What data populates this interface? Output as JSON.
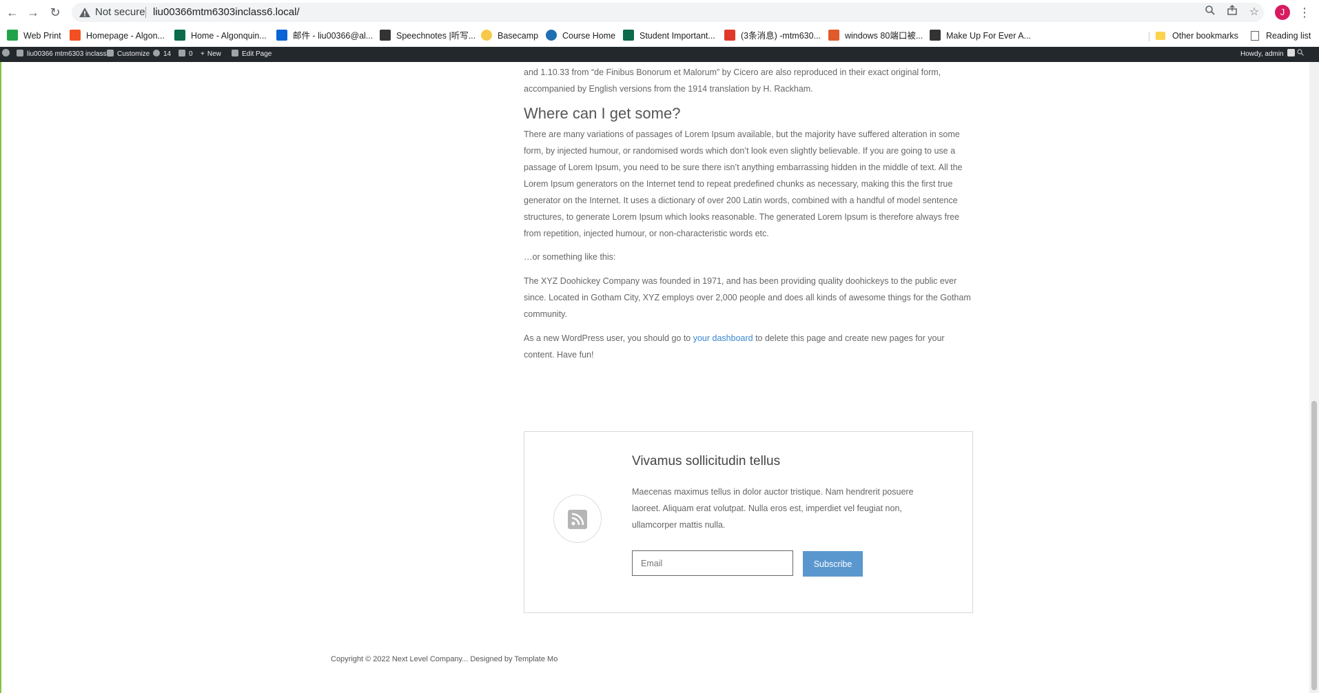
{
  "browser": {
    "security_text": "Not secure",
    "url": "liu00366mtm6303inclass6.local/",
    "profile_initial": "J",
    "bookmarks": [
      {
        "label": "Web Print",
        "color": "#22a34a"
      },
      {
        "label": "Homepage - Algon...",
        "color": "#f25022"
      },
      {
        "label": "Home - Algonquin...",
        "color": "#0b6b4b"
      },
      {
        "label": "邮件 - liu00366@al...",
        "color": "#0a64d6"
      },
      {
        "label": "Speechnotes |听写...",
        "color": "#333333"
      },
      {
        "label": "Basecamp",
        "color": "#f7c948"
      },
      {
        "label": "Course Home",
        "color": "#1f6fb2"
      },
      {
        "label": "Student Important...",
        "color": "#0b6b4b"
      },
      {
        "label": "(3条消息) -mtm630...",
        "color": "#e0392b"
      },
      {
        "label": "windows 80端口被...",
        "color": "#e05a2b"
      },
      {
        "label": "Make Up For Ever A...",
        "color": "#333333"
      }
    ],
    "other_bookmarks": "Other bookmarks",
    "reading_list": "Reading list"
  },
  "wp_admin_bar": {
    "site_name": "liu00366 mtm6303 inclass6",
    "customize": "Customize",
    "updates_count": "14",
    "comments_count": "0",
    "new": "New",
    "edit_page": "Edit Page",
    "howdy": "Howdy, admin"
  },
  "content": {
    "intro_line1": "and 1.10.33 from “de Finibus Bonorum et Malorum” by Cicero are also reproduced in their exact original form,",
    "intro_line2": "accompanied by English versions from the 1914 translation by H. Rackham.",
    "heading": "Where can I get some?",
    "paragraph1": "There are many variations of passages of Lorem Ipsum available, but the majority have suffered alteration in some form, by injected humour, or randomised words which don’t look even slightly believable. If you are going to use a passage of Lorem Ipsum, you need to be sure there isn’t anything embarrassing hidden in the middle of text. All the Lorem Ipsum generators on the Internet tend to repeat predefined chunks as necessary, making this the first true generator on the Internet. It uses a dictionary of over 200 Latin words, combined with a handful of model sentence structures, to generate Lorem Ipsum which looks reasonable. The generated Lorem Ipsum is therefore always free from repetition, injected humour, or non-characteristic words etc.",
    "paragraph2": "…or something like this:",
    "paragraph3": "The XYZ Doohickey Company was founded in 1971, and has been providing quality doohickeys to the public ever since. Located in Gotham City, XYZ employs over 2,000 people and does all kinds of awesome things for the Gotham community.",
    "paragraph4_before": "As a new WordPress user, you should go to ",
    "paragraph4_link": "your dashboard",
    "paragraph4_after": " to delete this page and create new pages for your content. Have fun!"
  },
  "subscribe_box": {
    "title": "Vivamus sollicitudin tellus",
    "text": "Maecenas maximus tellus in dolor auctor tristique. Nam hendrerit posuere laoreet. Aliquam erat volutpat. Nulla eros est, imperdiet vel feugiat non, ullamcorper mattis nulla.",
    "email_placeholder": "Email",
    "button_label": "Subscribe"
  },
  "footer": {
    "copyright": "Copyright © 2022 Next Level Company... Designed by Template Mo"
  }
}
